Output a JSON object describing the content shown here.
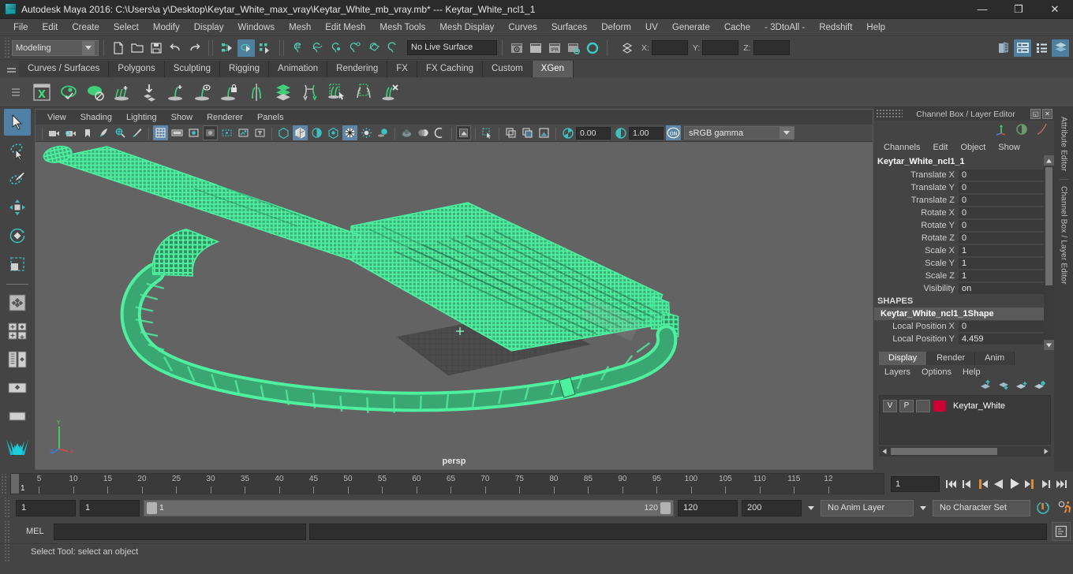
{
  "titlebar": {
    "app_title": "Autodesk Maya 2016: C:\\Users\\a y\\Desktop\\Keytar_White_max_vray\\Keytar_White_mb_vray.mb*   ---   Keytar_White_ncl1_1",
    "minimize": "—",
    "maximize": "❐",
    "close": "✕"
  },
  "menubar": {
    "items": [
      "File",
      "Edit",
      "Create",
      "Select",
      "Modify",
      "Display",
      "Windows",
      "Mesh",
      "Edit Mesh",
      "Mesh Tools",
      "Mesh Display",
      "Curves",
      "Surfaces",
      "Deform",
      "UV",
      "Generate",
      "Cache",
      "- 3DtoAll -",
      "Redshift",
      "Help"
    ]
  },
  "statusline": {
    "menuset": "Modeling",
    "live_surface": "No Live Surface",
    "coord_x_label": "X:",
    "coord_y_label": "Y:",
    "coord_z_label": "Z:",
    "coord_x_value": "",
    "coord_y_value": "",
    "coord_z_value": "",
    "icons": [
      "new-scene-icon",
      "open-scene-icon",
      "save-scene-icon",
      "undo-icon",
      "redo-icon",
      "select-by-hierarchy-icon",
      "select-by-object-icon",
      "select-by-component-icon",
      "snap-to-grid-icon",
      "snap-to-curve-icon",
      "snap-to-point-icon",
      "snap-to-projected-center-icon",
      "snap-to-view-plane-icon",
      "make-live-icon",
      "render-view-icon",
      "render-sequence-icon",
      "ipr-render-icon",
      "render-settings-icon",
      "hypershade-icon",
      "selection-mask-icon",
      "show-sidebar-attribute-icon",
      "show-sidebar-toolsettings-icon",
      "show-sidebar-channelbox-icon",
      "show-sidebar-layers-icon"
    ]
  },
  "shelf": {
    "tabs": [
      "Curves / Surfaces",
      "Polygons",
      "Sculpting",
      "Rigging",
      "Animation",
      "Rendering",
      "FX",
      "FX Caching",
      "Custom",
      "XGen"
    ],
    "active_tab": "XGen",
    "icons": [
      "xgen-editor-icon",
      "preview-refresh-icon",
      "disable-preview-icon",
      "add-grooming-description-icon",
      "import-preset-icon",
      "add-guide-icon",
      "show-guide-icon",
      "lock-guide-icon",
      "mirror-guide-icon",
      "sculpt-layers-icon",
      "transfer-guides-icon",
      "select-region-icon",
      "select-box-icon",
      "delete-guide-icon"
    ]
  },
  "toolbox": {
    "items": [
      "select-tool",
      "lasso-select-tool",
      "paint-select-tool",
      "move-tool",
      "rotate-tool",
      "scale-tool",
      "last-tool",
      "single-pane-layout",
      "four-pane-layout",
      "persp-outliner-layout",
      "persp-graph-layout",
      "maya-logo"
    ],
    "active": "select-tool"
  },
  "viewport": {
    "menus": [
      "View",
      "Shading",
      "Lighting",
      "Show",
      "Renderer",
      "Panels"
    ],
    "camera_label": "persp",
    "exposure_value": "0.00",
    "gamma_value": "1.00",
    "color_management": "sRGB gamma",
    "gamma_toggle": "ON",
    "toolbar_icons": [
      "select-camera-icon",
      "camera-attributes-icon",
      "bookmark-icon",
      "image-plane-icon",
      "two-d-pan-zoom-icon",
      "grease-pencil-icon",
      "grid-toggle-icon",
      "film-gate-icon",
      "resolution-gate-icon",
      "gate-mask-icon",
      "field-chart-icon",
      "safe-action-icon",
      "safe-title-icon",
      "wireframe-icon",
      "smooth-shade-all-icon",
      "shade-x-ray-icon",
      "shade-x-ray-joints-icon",
      "texture-toggle-icon",
      "lighting-toggle-icon",
      "shadows-icon",
      "screen-space-ao-icon",
      "motion-blur-icon",
      "multisample-icon",
      "isolate-select-icon",
      "xray-selected-icon",
      "display-selected-icon",
      "display-unselected-icon",
      "exposure-icon",
      "gamma-icon"
    ],
    "object_color": "#4ef0a0",
    "background_color": "#636363"
  },
  "channelbox": {
    "panel_title": "Channel Box / Layer Editor",
    "restore_glyph": "◱",
    "close_glyph": "✕",
    "menus": [
      "Channels",
      "Edit",
      "Object",
      "Show"
    ],
    "object_name": "Keytar_White_ncl1_1",
    "transform_attrs": [
      {
        "label": "Translate X",
        "value": "0"
      },
      {
        "label": "Translate Y",
        "value": "0"
      },
      {
        "label": "Translate Z",
        "value": "0"
      },
      {
        "label": "Rotate X",
        "value": "0"
      },
      {
        "label": "Rotate Y",
        "value": "0"
      },
      {
        "label": "Rotate Z",
        "value": "0"
      },
      {
        "label": "Scale X",
        "value": "1"
      },
      {
        "label": "Scale Y",
        "value": "1"
      },
      {
        "label": "Scale Z",
        "value": "1"
      },
      {
        "label": "Visibility",
        "value": "on"
      }
    ],
    "shapes_header": "SHAPES",
    "shape_name": "Keytar_White_ncl1_1Shape",
    "shape_attrs": [
      {
        "label": "Local Position X",
        "value": "0"
      },
      {
        "label": "Local Position Y",
        "value": "4.459"
      }
    ]
  },
  "layereditor": {
    "tabs": [
      "Display",
      "Render",
      "Anim"
    ],
    "active_tab": "Display",
    "menus": [
      "Layers",
      "Options",
      "Help"
    ],
    "buttons": [
      "move-layer-up-icon",
      "move-layer-down-icon",
      "new-layer-icon",
      "new-layer-from-selected-icon"
    ],
    "layers": [
      {
        "visibility": "V",
        "playback": "P",
        "shading": "",
        "color": "#cc0033",
        "name": "Keytar_White"
      }
    ]
  },
  "sidetabs": {
    "items": [
      "Attribute Editor",
      "Channel Box / Layer Editor"
    ]
  },
  "timeline": {
    "labels": [
      "5",
      "10",
      "15",
      "20",
      "25",
      "30",
      "35",
      "40",
      "45",
      "50",
      "55",
      "60",
      "65",
      "70",
      "75",
      "80",
      "85",
      "90",
      "95",
      "100",
      "105",
      "110",
      "115",
      "12"
    ],
    "start_frame": "1",
    "current_frame": "1",
    "playback_buttons": [
      "go-to-start-icon",
      "step-back-key-icon",
      "step-back-frame-icon",
      "play-backwards-icon",
      "play-forwards-icon",
      "step-forward-frame-icon",
      "step-forward-key-icon",
      "go-to-end-icon"
    ]
  },
  "rangeslider": {
    "anim_start": "1",
    "range_start": "1",
    "slider_min": "1",
    "slider_max": "120",
    "range_end": "120",
    "anim_end": "200",
    "anim_layer": "No Anim Layer",
    "character_set": "No Character Set",
    "icons": [
      "auto-key-icon",
      "animation-preferences-icon"
    ]
  },
  "commandline": {
    "language_label": "MEL",
    "input_value": "",
    "output_value": "",
    "script-editor-icon": "script-editor-icon"
  },
  "helpline": {
    "text": "Select Tool: select an object"
  }
}
